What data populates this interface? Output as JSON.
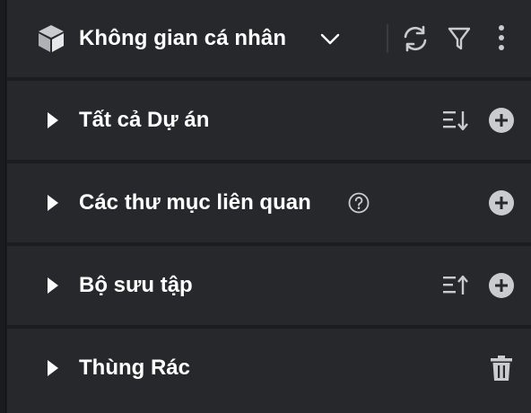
{
  "header": {
    "workspace_title": "Không gian cá nhân",
    "icons": [
      "workspace-cube-icon",
      "chevron-down-icon",
      "refresh-icon",
      "filter-icon",
      "more-vertical-icon"
    ]
  },
  "sections": [
    {
      "label": "Tất cả Dự án",
      "actions": [
        "sort-descending-icon",
        "add-circle-icon"
      ]
    },
    {
      "label": "Các thư mục liên quan",
      "actions": [
        "help-circle-icon",
        "add-circle-icon"
      ]
    },
    {
      "label": "Bộ sưu tập",
      "actions": [
        "sort-ascending-icon",
        "add-circle-icon"
      ]
    },
    {
      "label": "Thùng Rác",
      "actions": [
        "trash-icon"
      ]
    }
  ],
  "colors": {
    "background": "#1c1d20",
    "panel": "#26282b",
    "icon": "#c9cbcf",
    "text": "#ffffff"
  }
}
